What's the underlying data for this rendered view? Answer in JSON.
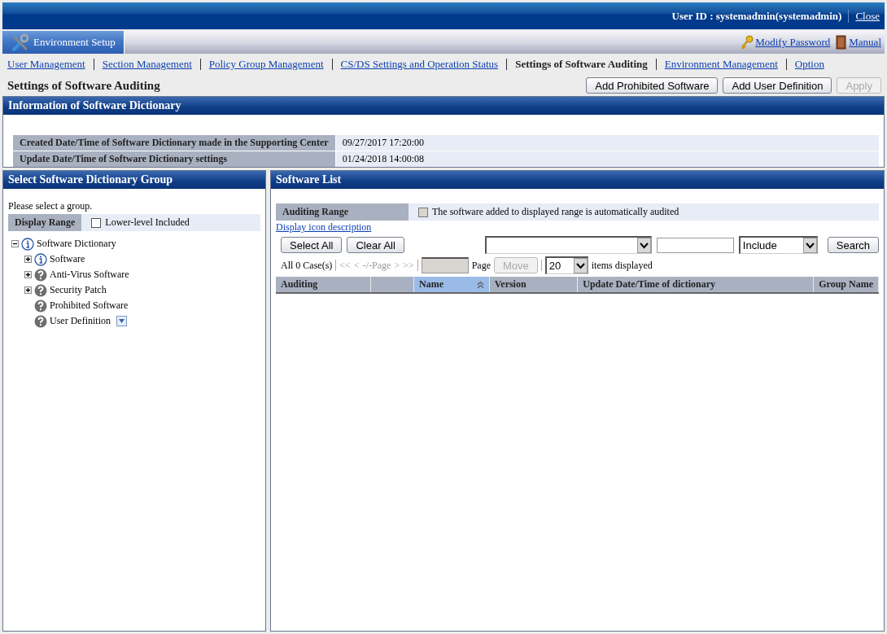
{
  "header": {
    "user_id": "User ID : systemadmin(systemadmin)",
    "close_link": "Close"
  },
  "module_tab": {
    "label": "Environment Setup",
    "selected": true
  },
  "header_links": [
    {
      "kind": "key",
      "label": "Modify Password"
    },
    {
      "kind": "book",
      "label": "Manual"
    }
  ],
  "nav": [
    {
      "label": "User Management",
      "selected": false
    },
    {
      "label": "Section Management",
      "selected": false
    },
    {
      "label": "Policy Group Management",
      "selected": false
    },
    {
      "label": "CS/DS Settings and Operation Status",
      "selected": false
    },
    {
      "label": "Settings of Software Auditing",
      "selected": true
    },
    {
      "label": "Environment Management",
      "selected": false
    },
    {
      "label": "Option",
      "selected": false
    }
  ],
  "page_title": "Settings of Software Auditing",
  "actions": [
    {
      "label": "Add Prohibited Software",
      "disabled": false
    },
    {
      "label": "Add User Definition",
      "disabled": false
    },
    {
      "label": "Apply",
      "disabled": true
    }
  ],
  "info_panel": {
    "title": "Information of Software Dictionary",
    "rows": [
      {
        "label": "Created Date/Time of Software Dictionary made in the Supporting Center",
        "value": "09/27/2017 17:20:00"
      },
      {
        "label": "Update Date/Time of Software Dictionary settings",
        "value": "01/24/2018 14:00:08"
      }
    ]
  },
  "group_panel": {
    "title": "Select Software Dictionary Group",
    "hint": "Please select a group.",
    "display_range": {
      "label": "Display Range",
      "option": "Lower-level Included",
      "checked": false
    },
    "tree": [
      {
        "label": "Software Dictionary",
        "kind": "info",
        "expandable": true,
        "expanded": true,
        "menu": false,
        "children": [
          {
            "label": "Software",
            "kind": "info",
            "expandable": true,
            "expanded": false,
            "menu": false
          },
          {
            "label": "Anti-Virus Software",
            "kind": "question",
            "expandable": true,
            "expanded": false,
            "menu": false
          },
          {
            "label": "Security Patch",
            "kind": "question",
            "expandable": true,
            "expanded": false,
            "menu": false
          },
          {
            "label": "Prohibited Software",
            "kind": "question",
            "expandable": false,
            "menu": false
          },
          {
            "label": "User Definition",
            "kind": "question",
            "expandable": false,
            "menu": true
          }
        ]
      }
    ]
  },
  "list_panel": {
    "title": "Software List",
    "auditing_range": {
      "label": "Auditing Range",
      "option": "The software added to displayed range is automatically audited",
      "checked": false
    },
    "icon_help_link": "Display icon description",
    "buttons": [
      "Select All",
      "Clear All"
    ],
    "search": {
      "match": "Include",
      "button": "Search"
    },
    "pager": {
      "count": "All 0 Case(s)",
      "first": "<<",
      "prev": "<",
      "page": "-/-Page",
      "next": ">",
      "last": ">>",
      "page_label": "Page",
      "move": "Move",
      "per_page": "20",
      "per_page_label": "items displayed"
    },
    "columns": [
      {
        "label": "Auditing",
        "sorted": false
      },
      {
        "sorted": false
      },
      {
        "label": "Name",
        "sorted": true
      },
      {
        "label": "Version",
        "sorted": false
      },
      {
        "label": "Update Date/Time of dictionary",
        "sorted": false
      },
      {
        "label": "Group Name",
        "sorted": false
      }
    ]
  }
}
